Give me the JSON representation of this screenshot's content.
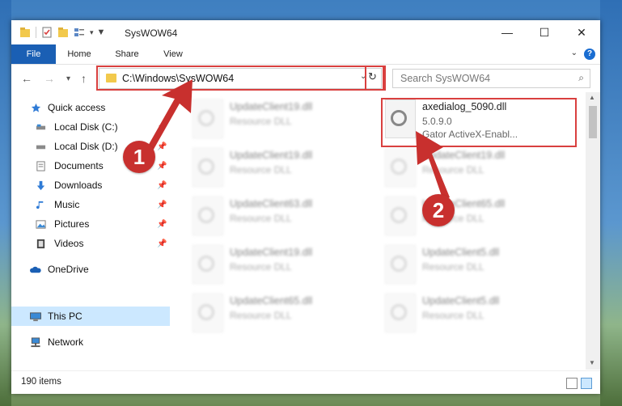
{
  "window": {
    "title": "SysWOW64",
    "controls": {
      "minimize": "—",
      "maximize": "☐",
      "close": "✕"
    }
  },
  "ribbon": {
    "tabs": [
      {
        "label": "File"
      },
      {
        "label": "Home"
      },
      {
        "label": "Share"
      },
      {
        "label": "View"
      }
    ],
    "help_icon": "?"
  },
  "nav": {
    "back_icon": "←",
    "forward_icon": "→",
    "history_icon": "▾",
    "up_icon": "↑",
    "address": "C:\\Windows\\SysWOW64",
    "refresh_icon": "↻",
    "search_placeholder": "Search SysWOW64"
  },
  "sidebar": {
    "items": [
      {
        "label": "Quick access",
        "icon": "star-icon",
        "pinned": false
      },
      {
        "label": "Local Disk (C:)",
        "icon": "drive-icon",
        "pinned": true
      },
      {
        "label": "Local Disk (D:)",
        "icon": "drive-icon",
        "pinned": true
      },
      {
        "label": "Documents",
        "icon": "documents-icon",
        "pinned": true
      },
      {
        "label": "Downloads",
        "icon": "downloads-icon",
        "pinned": true
      },
      {
        "label": "Music",
        "icon": "music-icon",
        "pinned": true
      },
      {
        "label": "Pictures",
        "icon": "pictures-icon",
        "pinned": true
      },
      {
        "label": "Videos",
        "icon": "videos-icon",
        "pinned": true
      },
      {
        "label": "OneDrive",
        "icon": "cloud-icon",
        "pinned": false
      },
      {
        "label": "This PC",
        "icon": "computer-icon",
        "pinned": false,
        "selected": true
      },
      {
        "label": "Network",
        "icon": "network-icon",
        "pinned": false
      }
    ]
  },
  "files": [
    {
      "name": "UpdateClient19.dll",
      "type": "Resource DLL",
      "blurred": true
    },
    {
      "name": "axedialog_5090.dll",
      "version": "5.0.9.0",
      "type": "Gator ActiveX-Enabl...",
      "blurred": false
    },
    {
      "name": "UpdateClient19.dll",
      "type": "Resource DLL",
      "blurred": true
    },
    {
      "name": "UpdateClient19.dll",
      "type": "Resource DLL",
      "blurred": true
    },
    {
      "name": "UpdateClient63.dll",
      "type": "Resource DLL",
      "blurred": true
    },
    {
      "name": "UpdateClient65.dll",
      "type": "Resource DLL",
      "blurred": true
    },
    {
      "name": "UpdateClient19.dll",
      "type": "Resource DLL",
      "blurred": true
    },
    {
      "name": "UpdateClient5.dll",
      "type": "Resource DLL",
      "blurred": true
    },
    {
      "name": "UpdateClient65.dll",
      "type": "Resource DLL",
      "blurred": true
    },
    {
      "name": "UpdateClient5.dll",
      "type": "Resource DLL",
      "blurred": true
    }
  ],
  "status": {
    "item_count": "190 items"
  },
  "annotations": {
    "step1": "1",
    "step2": "2"
  },
  "colors": {
    "accent": "#1a5fb4",
    "highlight": "#d9403f",
    "selection": "#cce8ff"
  }
}
